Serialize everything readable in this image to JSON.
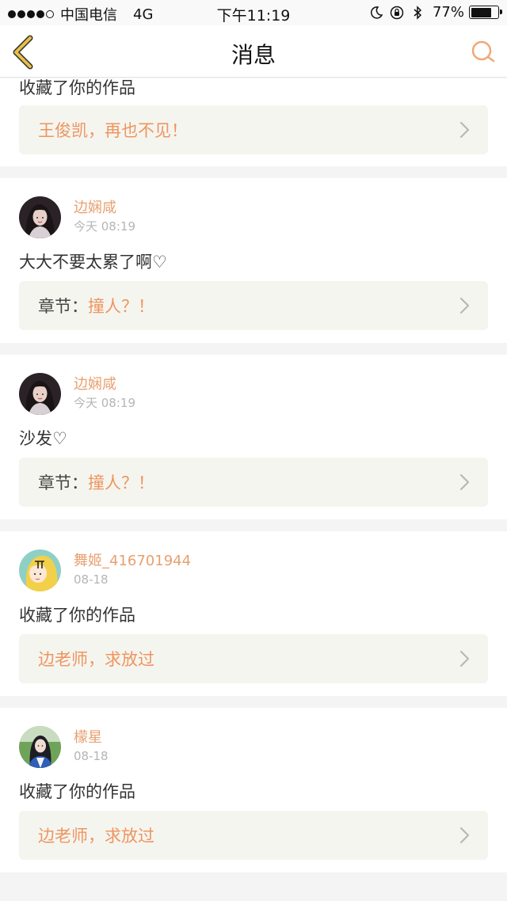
{
  "status_bar": {
    "carrier": "中国电信",
    "network": "4G",
    "time": "下午11:19",
    "battery": "77%",
    "battery_level": 0.77,
    "icons": [
      "moon-icon",
      "rotation-lock-icon",
      "bluetooth-icon",
      "battery-icon"
    ]
  },
  "nav": {
    "title": "消息",
    "back_icon": "chevron-left-icon",
    "search_icon": "search-icon"
  },
  "colors": {
    "accent": "#ee9560",
    "username": "#e8a070",
    "back_arrow": "#e6b84a",
    "ref_bg": "#f5f5ef"
  },
  "messages": [
    {
      "text": "收藏了你的作品",
      "ref_prefix": "",
      "ref_title": "王俊凯，再也不见！"
    },
    {
      "user": "边娴咸",
      "time": "今天 08:19",
      "avatar": "avatar-photo-girl-dark",
      "text": "大大不要太累了啊♡",
      "ref_prefix": "章节：",
      "ref_title": "撞人？！"
    },
    {
      "user": "边娴咸",
      "time": "今天 08:19",
      "avatar": "avatar-photo-girl-dark",
      "text": "沙发♡",
      "ref_prefix": "章节：",
      "ref_title": "撞人？！"
    },
    {
      "user": "舞姬_416701944",
      "time": "08-18",
      "avatar": "avatar-cartoon-girl-yellow-hair",
      "text": "收藏了你的作品",
      "ref_prefix": "",
      "ref_title": "边老师，求放过"
    },
    {
      "user": "檬星",
      "time": "08-18",
      "avatar": "avatar-photo-girl-outdoor",
      "text": "收藏了你的作品",
      "ref_prefix": "",
      "ref_title": "边老师，求放过"
    }
  ]
}
